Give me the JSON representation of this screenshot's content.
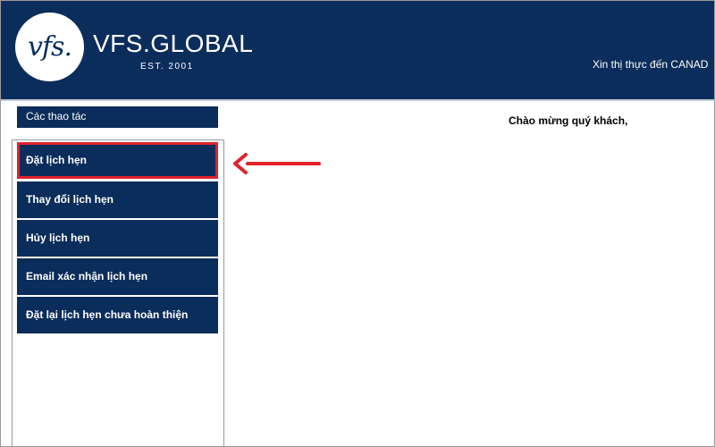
{
  "header": {
    "logo_mark": "vfs.",
    "logo_name": "VFS.GLOBAL",
    "logo_est": "EST. 2001",
    "right_text": "Xin thị thực đến CANAD"
  },
  "sidebar": {
    "title": "Các thao tác",
    "items": [
      {
        "label": "Đặt lịch hẹn",
        "highlighted": true
      },
      {
        "label": "Thay đổi lịch hẹn"
      },
      {
        "label": "Hủy lịch hẹn"
      },
      {
        "label": "Email xác nhận lịch hẹn"
      },
      {
        "label": "Đặt lại lịch hẹn chưa hoàn thiện"
      }
    ]
  },
  "main": {
    "welcome": "Chào mừng quý khách,"
  },
  "colors": {
    "brand_navy": "#0b2d5b",
    "highlight_red": "#e0222a"
  }
}
